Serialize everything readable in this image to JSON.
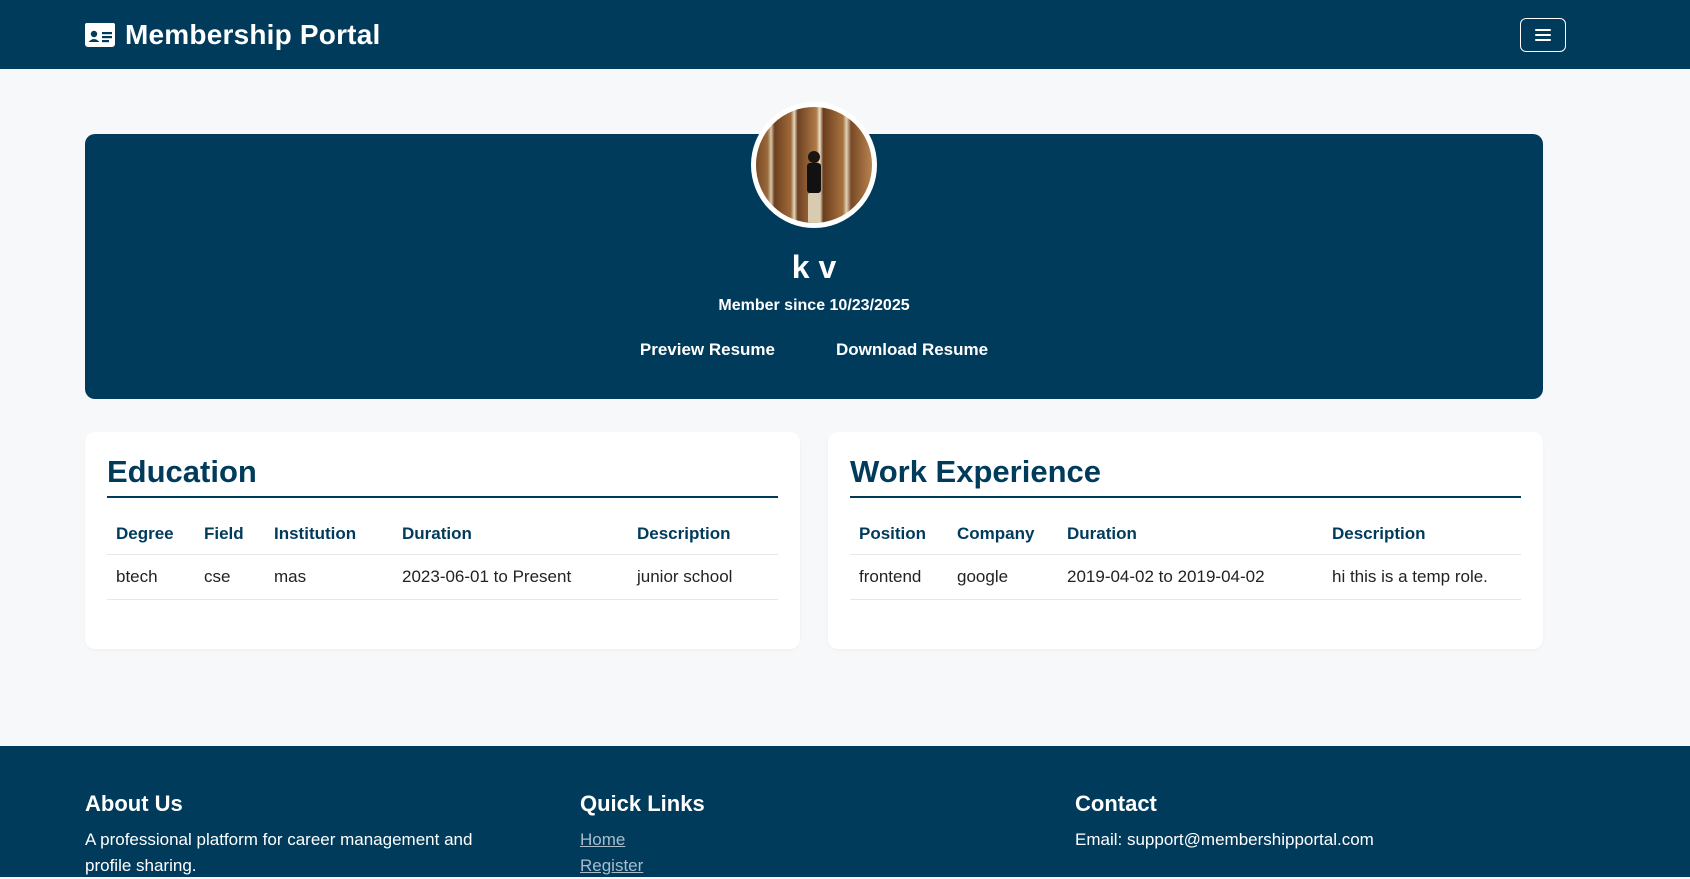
{
  "nav": {
    "brand": "Membership Portal",
    "brand_icon": "id-card-icon",
    "menu_icon": "hamburger-icon"
  },
  "profile": {
    "name": "k v",
    "member_since": "Member since 10/23/2025",
    "preview_resume": "Preview Resume",
    "download_resume": "Download Resume"
  },
  "education": {
    "title": "Education",
    "headers": [
      "Degree",
      "Field",
      "Institution",
      "Duration",
      "Description"
    ],
    "rows": [
      [
        "btech",
        "cse",
        "mas",
        "2023-06-01 to Present",
        "junior school"
      ]
    ]
  },
  "work": {
    "title": "Work Experience",
    "headers": [
      "Position",
      "Company",
      "Duration",
      "Description"
    ],
    "rows": [
      [
        "frontend",
        "google",
        "2019-04-02 to 2019-04-02",
        "hi this is a temp role."
      ]
    ]
  },
  "footer": {
    "about_title": "About Us",
    "about_text": "A professional platform for career management and profile sharing.",
    "links_title": "Quick Links",
    "links": [
      "Home",
      "Register"
    ],
    "contact_title": "Contact",
    "contact_email": "Email: support@membershipportal.com"
  },
  "colors": {
    "primary": "#003b5c",
    "background": "#f7f8fa",
    "link_muted": "#a9bccb"
  }
}
